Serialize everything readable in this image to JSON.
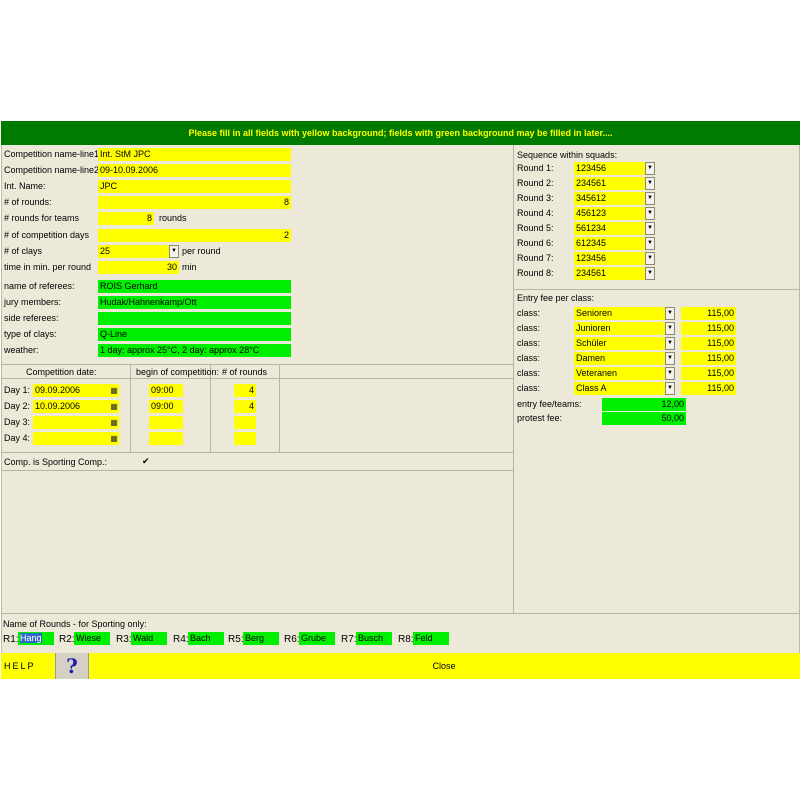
{
  "banner": "Please fill in all fields with yellow background; fields with green background may be filled in later....",
  "form": {
    "name1": {
      "label": "Competition name-line1",
      "value": "Int. StM JPC"
    },
    "name2": {
      "label": "Competition name-line2",
      "value": "09-10.09.2006"
    },
    "int_name": {
      "label": "Int. Name:",
      "value": "JPC"
    },
    "rounds": {
      "label": "# of rounds:",
      "value": "8"
    },
    "rounds_teams": {
      "label": "# rounds for teams",
      "value": "8",
      "suffix": "rounds"
    },
    "comp_days": {
      "label": "# of competition days",
      "value": "2"
    },
    "clays": {
      "label": "# of clays",
      "value": "25",
      "suffix": "per round"
    },
    "time_per_round": {
      "label": "time in min. per round",
      "value": "30",
      "suffix": "min"
    },
    "referees": {
      "label": "name of referees:",
      "value": "ROIS Gerhard"
    },
    "jury": {
      "label": "jury members:",
      "value": "Hudak/Hahnenkamp/Ott"
    },
    "side_referees": {
      "label": "side referees:",
      "value": ""
    },
    "clay_type": {
      "label": "type of clays:",
      "value": "Q-Line"
    },
    "weather": {
      "label": "weather:",
      "value": "1 day: approx 25°C, 2 day: approx 28°C"
    }
  },
  "days": {
    "headers": [
      "Competition date:",
      "begin of competition:",
      "# of rounds"
    ],
    "rows": [
      {
        "label": "Day 1:",
        "date": "09.09.2006",
        "begin": "09:00",
        "rounds": "4"
      },
      {
        "label": "Day 2:",
        "date": "10.09.2006",
        "begin": "09:00",
        "rounds": "4"
      },
      {
        "label": "Day 3:",
        "date": "",
        "begin": "",
        "rounds": ""
      },
      {
        "label": "Day 4:",
        "date": "",
        "begin": "",
        "rounds": ""
      }
    ]
  },
  "sporting": {
    "label": "Comp. is Sporting Comp.:",
    "check": "✔"
  },
  "sequence": {
    "title": "Sequence within squads:",
    "rounds": [
      {
        "label": "Round 1:",
        "value": "123456"
      },
      {
        "label": "Round 2:",
        "value": "234561"
      },
      {
        "label": "Round 3:",
        "value": "345612"
      },
      {
        "label": "Round 4:",
        "value": "456123"
      },
      {
        "label": "Round 5:",
        "value": "561234"
      },
      {
        "label": "Round 6:",
        "value": "612345"
      },
      {
        "label": "Round 7:",
        "value": "123456"
      },
      {
        "label": "Round 8:",
        "value": "234561"
      }
    ]
  },
  "fees": {
    "title": "Entry fee per class:",
    "classes": [
      {
        "label": "class:",
        "name": "Senioren",
        "fee": "115,00"
      },
      {
        "label": "class:",
        "name": "Junioren",
        "fee": "115,00"
      },
      {
        "label": "class:",
        "name": "Schüler",
        "fee": "115,00"
      },
      {
        "label": "class:",
        "name": "Damen",
        "fee": "115,00"
      },
      {
        "label": "class:",
        "name": "Veteranen",
        "fee": "115,00"
      },
      {
        "label": "class:",
        "name": "Class A",
        "fee": "115,00"
      }
    ],
    "team_fee": {
      "label": "entry fee/teams:",
      "value": "12,00"
    },
    "protest_fee": {
      "label": "protest fee:",
      "value": "50,00"
    }
  },
  "round_names": {
    "title": "Name of Rounds - for Sporting only:",
    "items": [
      {
        "label": "R1:",
        "value": "Hang"
      },
      {
        "label": "R2:",
        "value": "Wiese"
      },
      {
        "label": "R3:",
        "value": "Wald"
      },
      {
        "label": "R4:",
        "value": "Bach"
      },
      {
        "label": "R5:",
        "value": "Berg"
      },
      {
        "label": "R6:",
        "value": "Grube"
      },
      {
        "label": "R7:",
        "value": "Busch"
      },
      {
        "label": "R8:",
        "value": "Feld"
      }
    ]
  },
  "bottom": {
    "help_label": "HELP",
    "help_icon": "?",
    "close_label": "Close"
  },
  "colors": {
    "header_green": "#007A00",
    "banner_text": "#ffff00",
    "required": "#ffff00",
    "optional": "#00ee00",
    "panel_bg": "#ECE9D8"
  }
}
